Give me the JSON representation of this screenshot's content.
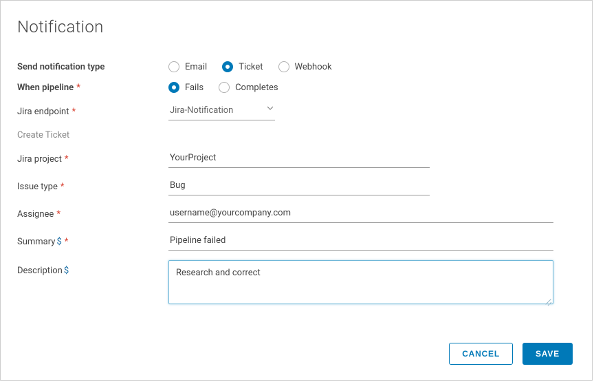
{
  "title": "Notification",
  "labels": {
    "notif_type": "Send notification type",
    "when_pipeline": "When pipeline",
    "jira_endpoint": "Jira endpoint",
    "create_ticket": "Create Ticket",
    "jira_project": "Jira project",
    "issue_type": "Issue type",
    "assignee": "Assignee",
    "summary": "Summary",
    "description": "Description"
  },
  "notif_type": {
    "options": [
      {
        "label": "Email",
        "selected": false
      },
      {
        "label": "Ticket",
        "selected": true
      },
      {
        "label": "Webhook",
        "selected": false
      }
    ]
  },
  "when_pipeline": {
    "options": [
      {
        "label": "Fails",
        "selected": true
      },
      {
        "label": "Completes",
        "selected": false
      }
    ]
  },
  "jira_endpoint": {
    "value": "Jira-Notification"
  },
  "jira_project": {
    "value": "YourProject"
  },
  "issue_type": {
    "value": "Bug"
  },
  "assignee": {
    "value": "username@yourcompany.com"
  },
  "summary": {
    "value": "Pipeline failed"
  },
  "description": {
    "value": "Research and correct"
  },
  "buttons": {
    "cancel": "CANCEL",
    "save": "SAVE"
  },
  "symbols": {
    "required": "*",
    "variable": "$"
  },
  "colors": {
    "primary": "#0079b8",
    "danger": "#d84030"
  }
}
